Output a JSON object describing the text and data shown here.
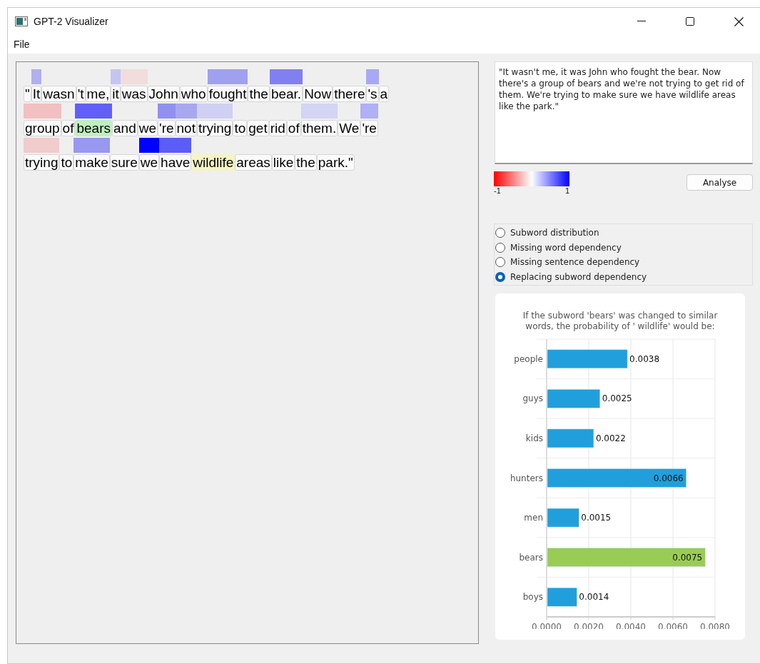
{
  "window": {
    "title": "GPT-2 Visualizer"
  },
  "menu": [
    "File"
  ],
  "token_lines": [
    [
      {
        "text": "\"",
        "kind": "plain"
      },
      {
        "text": "It",
        "kind": "plain",
        "color": "#b0b0f0"
      },
      {
        "text": "wasn",
        "kind": "plain"
      },
      {
        "text": "'t",
        "kind": "plain"
      },
      {
        "text": "me,",
        "kind": "plain"
      },
      {
        "text": "it",
        "kind": "plain",
        "color": "#c4c4f4"
      },
      {
        "text": "was",
        "kind": "plain",
        "color": "#f2dcdc"
      },
      {
        "text": "John",
        "kind": "plain"
      },
      {
        "text": "who",
        "kind": "plain"
      },
      {
        "text": "fought",
        "kind": "plain",
        "color": "#a0a0f0"
      },
      {
        "text": "the",
        "kind": "plain"
      },
      {
        "text": "bear.",
        "kind": "plain",
        "color": "#8080f0"
      },
      {
        "text": "Now",
        "kind": "plain"
      },
      {
        "text": "there",
        "kind": "plain"
      },
      {
        "text": "'s",
        "kind": "plain",
        "color": "#a8a8f4"
      },
      {
        "text": "a",
        "kind": "plain"
      }
    ],
    [
      {
        "text": "group",
        "kind": "plain",
        "color": "#f2c0c0"
      },
      {
        "text": "of",
        "kind": "plain"
      },
      {
        "text": "bears",
        "kind": "source",
        "color": "#6060f8"
      },
      {
        "text": "and",
        "kind": "plain"
      },
      {
        "text": "we",
        "kind": "plain"
      },
      {
        "text": "'re",
        "kind": "plain",
        "color": "#9090f0"
      },
      {
        "text": "not",
        "kind": "plain",
        "color": "#a8a8f0"
      },
      {
        "text": "trying",
        "kind": "plain",
        "color": "#d0d0f4"
      },
      {
        "text": "to",
        "kind": "plain"
      },
      {
        "text": "get",
        "kind": "plain"
      },
      {
        "text": "rid",
        "kind": "plain"
      },
      {
        "text": "of",
        "kind": "plain"
      },
      {
        "text": "them.",
        "kind": "plain",
        "color": "#d4d4f4"
      },
      {
        "text": "We",
        "kind": "plain"
      },
      {
        "text": "'re",
        "kind": "plain",
        "color": "#b0b0f4"
      }
    ],
    [
      {
        "text": "trying",
        "kind": "plain",
        "color": "#f0cccc"
      },
      {
        "text": "to",
        "kind": "plain"
      },
      {
        "text": "make",
        "kind": "plain",
        "color": "#9898f0"
      },
      {
        "text": "sure",
        "kind": "plain"
      },
      {
        "text": "we",
        "kind": "plain",
        "color": "#0000ff"
      },
      {
        "text": "have",
        "kind": "plain",
        "color": "#5c5cf8"
      },
      {
        "text": "wildlife",
        "kind": "target"
      },
      {
        "text": "areas",
        "kind": "plain"
      },
      {
        "text": "like",
        "kind": "plain"
      },
      {
        "text": "the",
        "kind": "plain"
      },
      {
        "text": "park.\"",
        "kind": "plain"
      }
    ]
  ],
  "input": {
    "value": "\"It wasn't me, it was John who fought the bear. Now there's a group of bears and we're not trying to get rid of them. We're trying to make sure we have wildlife areas like the park.\""
  },
  "legend": {
    "min_label": "-1",
    "max_label": "1"
  },
  "analyse_button": "Analyse",
  "modes": [
    {
      "label": "Subword distribution",
      "selected": false
    },
    {
      "label": "Missing word dependency",
      "selected": false
    },
    {
      "label": "Missing sentence dependency",
      "selected": false
    },
    {
      "label": "Replacing subword dependency",
      "selected": true
    }
  ],
  "chart_data": {
    "type": "bar",
    "orientation": "horizontal",
    "data_labels": true,
    "grid": true,
    "title": "If the subword 'bears' was changed to similar words, the probability of ' wildlife' would be:",
    "categories": [
      "people",
      "guys",
      "kids",
      "hunters",
      "men",
      "bears",
      "boys"
    ],
    "stacked": true,
    "series": [
      {
        "color": "#219fdd",
        "values": [
          0.0038,
          0.0025,
          0.0022,
          0.0066,
          0.0015,
          null,
          0.0014
        ]
      },
      {
        "color": "#99cc55",
        "values": [
          null,
          null,
          null,
          null,
          null,
          0.0075,
          null
        ]
      }
    ],
    "xlim": [
      0,
      0.008
    ],
    "xticks": [
      {
        "value": 0,
        "label": "0.0000"
      },
      {
        "value": 0.002,
        "label": "0.0020"
      },
      {
        "value": 0.004,
        "label": "0.0040"
      },
      {
        "value": 0.006,
        "label": "0.0060"
      },
      {
        "value": 0.008,
        "label": "0.0080"
      }
    ]
  }
}
